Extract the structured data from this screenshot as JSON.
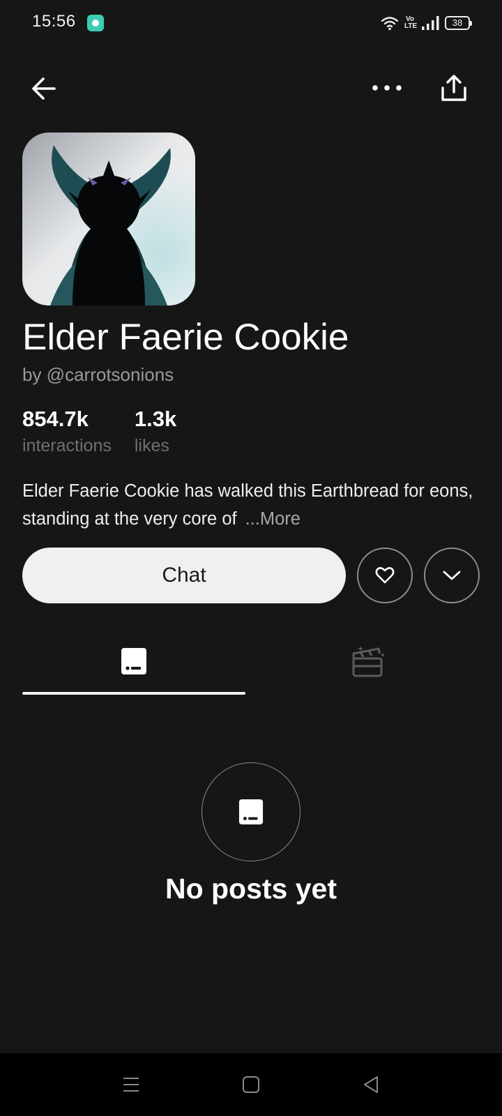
{
  "status_bar": {
    "time": "15:56",
    "network": "Vo LTE",
    "battery": "38",
    "icons": [
      "app-notification-icon",
      "wifi-icon",
      "signal-icon",
      "battery-icon"
    ]
  },
  "top_bar": {
    "icons": [
      "back-arrow-icon",
      "more-dots-icon",
      "share-icon"
    ]
  },
  "character": {
    "name": "Elder Faerie Cookie",
    "creator": "by @carrotsonions",
    "stats": [
      {
        "value": "854.7k",
        "label": "interactions"
      },
      {
        "value": "1.3k",
        "label": "likes"
      }
    ],
    "description": "Elder Faerie Cookie has walked this Earthbread for eons, standing at the very core of",
    "more_label": "...More"
  },
  "actions": {
    "chat_label": "Chat",
    "icons": [
      "heart-icon",
      "chevron-down-icon"
    ]
  },
  "tabs": {
    "items": [
      {
        "icon": "post-card-icon",
        "active": true
      },
      {
        "icon": "clapperboard-icon",
        "active": false
      }
    ]
  },
  "empty_state": {
    "icon": "post-card-icon",
    "text": "No posts yet"
  },
  "nav_bar": {
    "icons": [
      "menu-lines-icon",
      "home-square-icon",
      "back-triangle-icon"
    ]
  },
  "colors": {
    "background": "#161616",
    "primary_text": "#ffffff",
    "secondary_text": "#9a9a9a",
    "muted_text": "#6f6f6f",
    "chat_button_bg": "#f0f0f0",
    "accent_teal": "#3ccbb4",
    "nav_bar_bg": "#000000"
  }
}
